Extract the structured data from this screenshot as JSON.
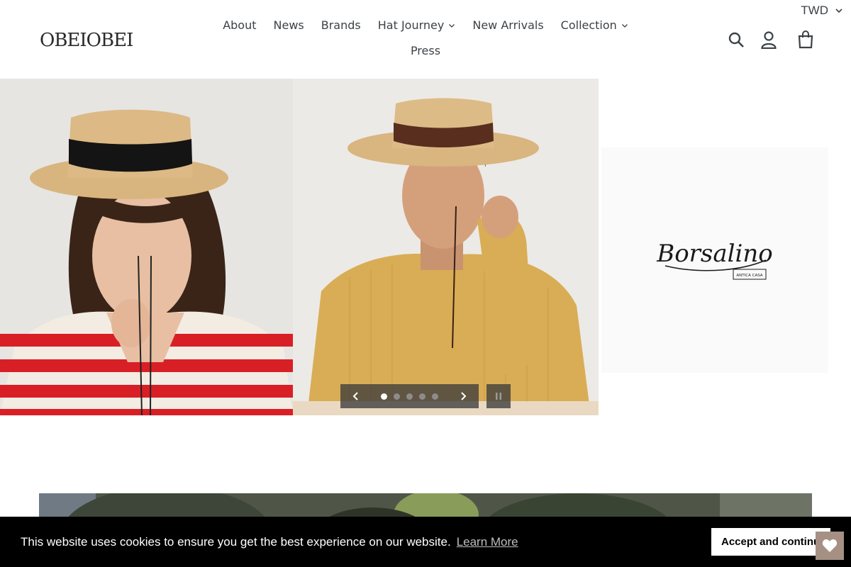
{
  "currency": {
    "selected": "TWD"
  },
  "brand": {
    "logo_text": "OBEIOBEI+"
  },
  "nav": {
    "items": [
      {
        "label": "About"
      },
      {
        "label": "News"
      },
      {
        "label": "Brands"
      },
      {
        "label": "Hat Journey"
      },
      {
        "label": "New Arrivals"
      },
      {
        "label": "Collection"
      },
      {
        "label": "Press"
      }
    ]
  },
  "header_icons": [
    "search-icon",
    "account-icon",
    "cart-icon"
  ],
  "slideshow": {
    "brand_card_logo": "Borsalino",
    "brand_card_sub": "ANTICA CASA",
    "slide_count": 5,
    "active_index": 0
  },
  "cookie": {
    "message": "This website uses cookies to ensure you get the best experience on our website.",
    "learn_more": "Learn More",
    "accept": "Accept and continue"
  },
  "colors": {
    "text": "#3d4246",
    "cookie_bg": "#000000",
    "wishlist": "#a59083"
  }
}
